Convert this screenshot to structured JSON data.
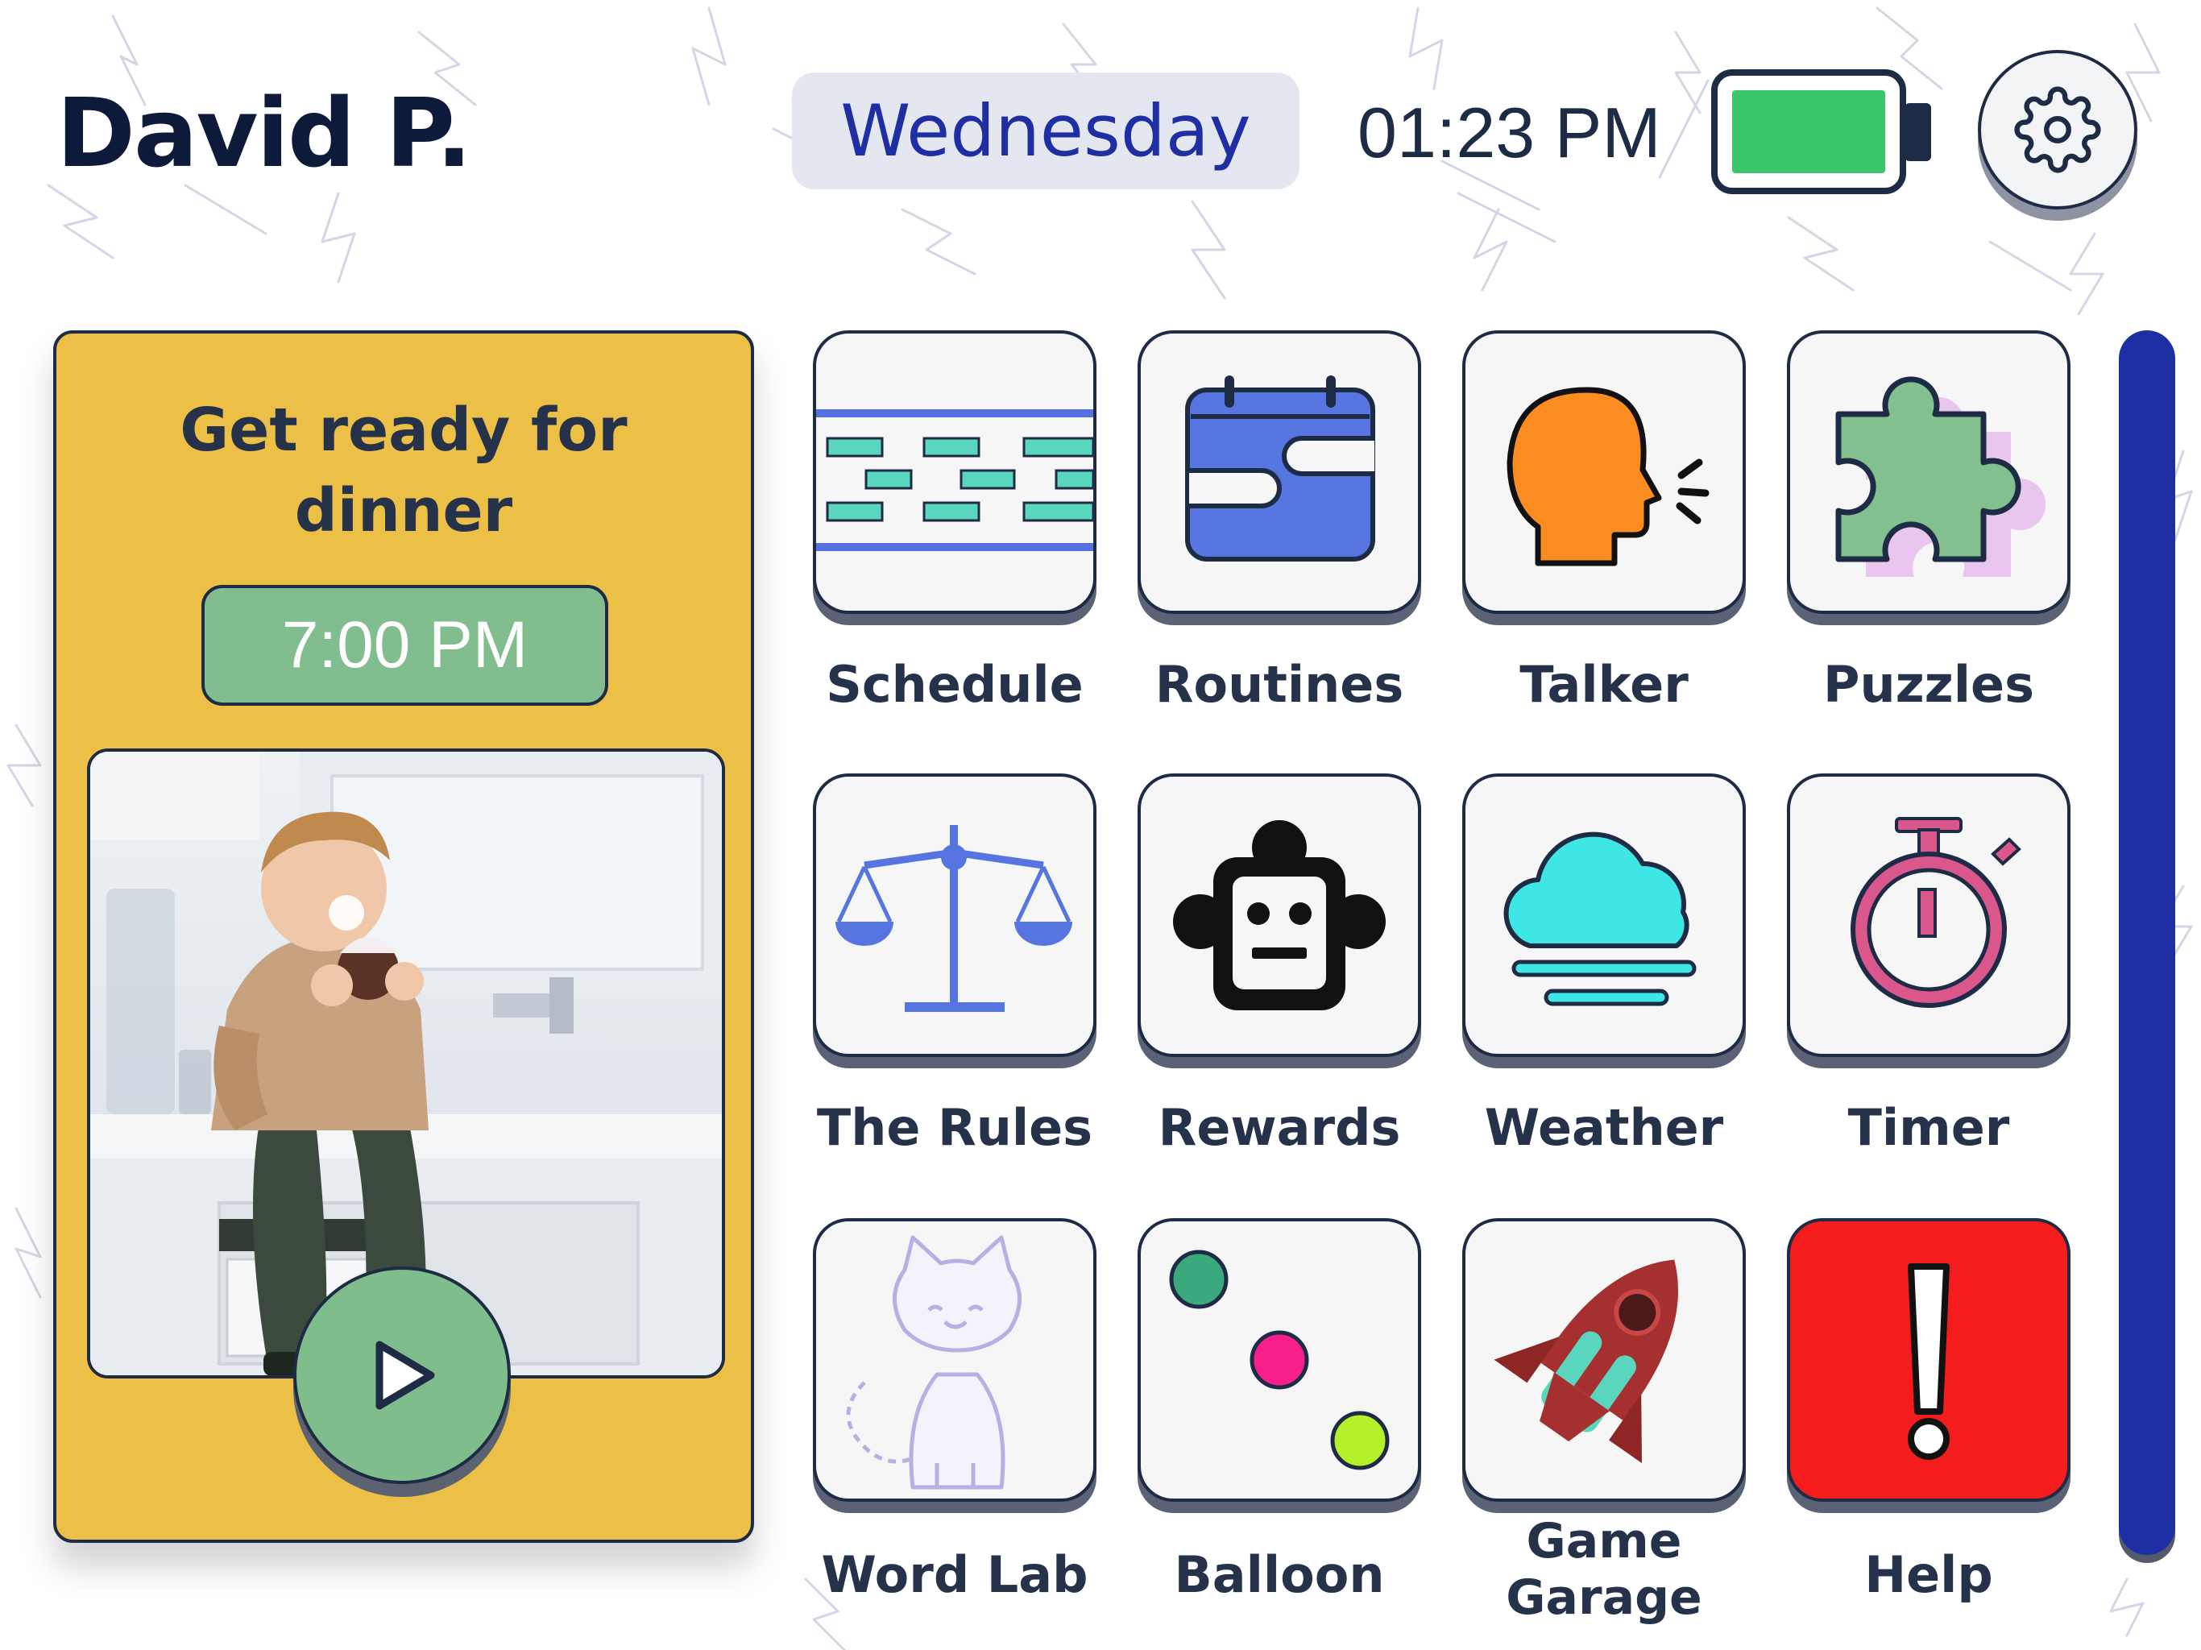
{
  "header": {
    "user_name": "David P.",
    "day": "Wednesday",
    "time": "01:23 PM",
    "battery_level": 1.0,
    "settings_icon": "gear-icon"
  },
  "reminder": {
    "title": "Get ready for dinner",
    "time": "7:00 PM",
    "play_icon": "play-icon"
  },
  "apps": [
    {
      "label": "Schedule",
      "icon": "schedule-icon"
    },
    {
      "label": "Routines",
      "icon": "calendar-icon"
    },
    {
      "label": "Talker",
      "icon": "speaking-head-icon"
    },
    {
      "label": "Puzzles",
      "icon": "puzzle-piece-icon"
    },
    {
      "label": "The Rules",
      "icon": "balance-scale-icon"
    },
    {
      "label": "Rewards",
      "icon": "robot-icon"
    },
    {
      "label": "Weather",
      "icon": "cloud-icon"
    },
    {
      "label": "Timer",
      "icon": "stopwatch-icon"
    },
    {
      "label": "Word Lab",
      "icon": "cat-icon"
    },
    {
      "label": "Balloon",
      "icon": "balloon-dots-icon"
    },
    {
      "label": "Game Garage",
      "label_lines": [
        "Game",
        "Garage"
      ],
      "icon": "rocket-icon"
    },
    {
      "label": "Help",
      "icon": "exclamation-icon"
    }
  ],
  "colors": {
    "accent_navy": "#1e2fa3",
    "reminder_yellow": "#ecbf46",
    "reminder_green": "#82bd8f",
    "battery_green": "#3cc66a",
    "help_red": "#f41c1c"
  }
}
